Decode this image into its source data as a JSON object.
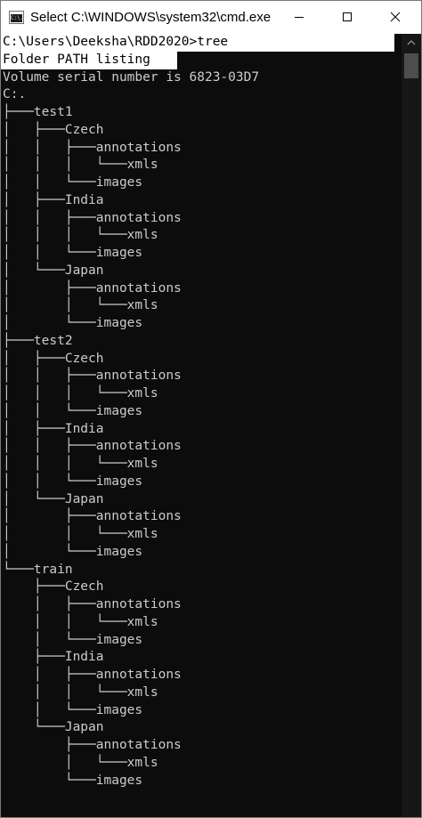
{
  "window": {
    "title": "Select C:\\WINDOWS\\system32\\cmd.exe",
    "icon": "cmd-console-icon",
    "icon_text": "C:\\."
  },
  "controls": {
    "minimize_icon": "minimize-icon",
    "maximize_icon": "maximize-icon",
    "close_icon": "close-icon"
  },
  "console": {
    "background": "#0c0c0c",
    "foreground": "#cccccc",
    "selection_background": "#ffffff",
    "selection_foreground": "#000000",
    "lines": [
      "C:\\Users\\Deeksha\\RDD2020>tree",
      "Folder PATH listing",
      "Volume serial number is 6823-03D7",
      "C:.",
      "├───test1",
      "│   ├───Czech",
      "│   │   ├───annotations",
      "│   │   │   └───xmls",
      "│   │   └───images",
      "│   ├───India",
      "│   │   ├───annotations",
      "│   │   │   └───xmls",
      "│   │   └───images",
      "│   └───Japan",
      "│       ├───annotations",
      "│       │   └───xmls",
      "│       └───images",
      "├───test2",
      "│   ├───Czech",
      "│   │   ├───annotations",
      "│   │   │   └───xmls",
      "│   │   └───images",
      "│   ├───India",
      "│   │   ├───annotations",
      "│   │   │   └───xmls",
      "│   │   └───images",
      "│   └───Japan",
      "│       ├───annotations",
      "│       │   └───xmls",
      "│       └───images",
      "└───train",
      "    ├───Czech",
      "    │   ├───annotations",
      "    │   │   └───xmls",
      "    │   └───images",
      "    ├───India",
      "    │   ├───annotations",
      "    │   │   └───xmls",
      "    │   └───images",
      "    └───Japan",
      "        ├───annotations",
      "        │   └───xmls",
      "        └───images"
    ]
  },
  "scrollbar": {
    "up_icon": "scroll-up-arrow-icon"
  }
}
